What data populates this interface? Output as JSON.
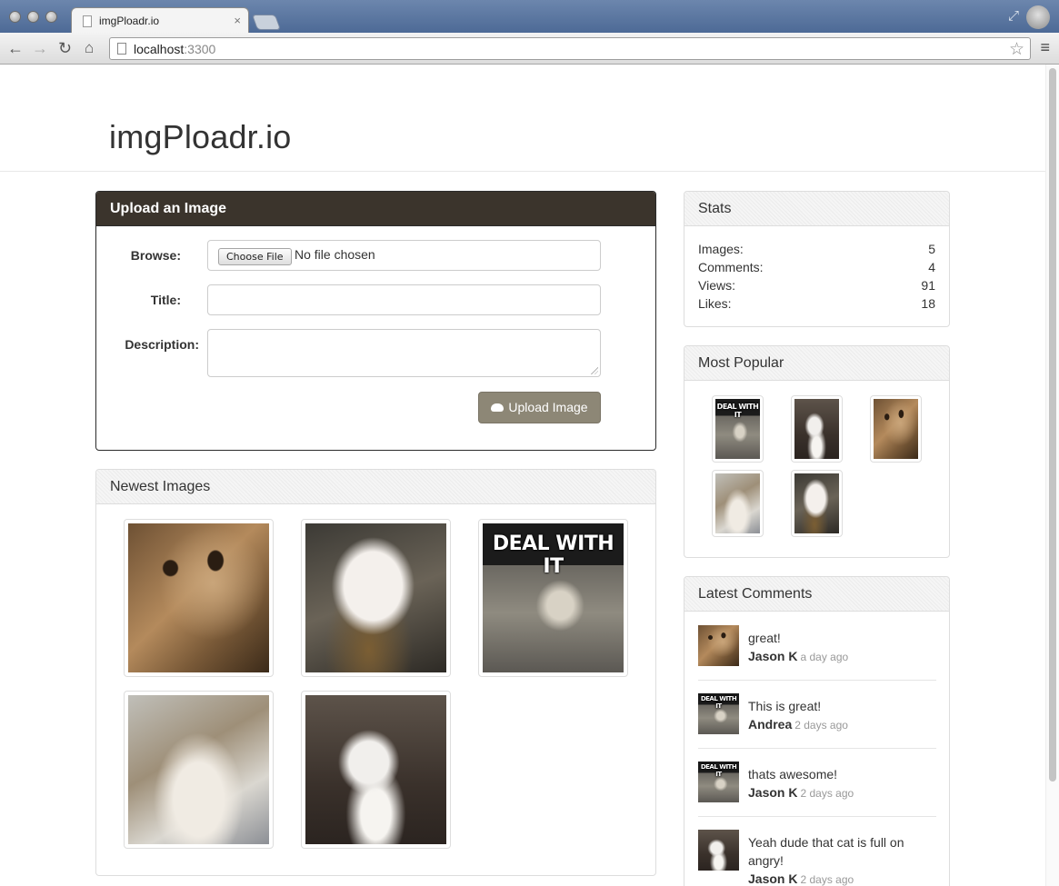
{
  "browser": {
    "tab_title": "imgPloadr.io",
    "tab_close": "×",
    "url_host": "localhost",
    "url_port": ":3300",
    "back_icon": "arrow-left",
    "forward_icon": "arrow-right",
    "reload_icon": "reload",
    "home_icon": "home",
    "star_icon": "star",
    "menu_icon": "hamburger"
  },
  "site": {
    "title": "imgPloadr.io"
  },
  "upload": {
    "heading": "Upload an Image",
    "browse_label": "Browse:",
    "choose_file": "Choose File",
    "file_status": "No file chosen",
    "title_label": "Title:",
    "title_value": "",
    "description_label": "Description:",
    "description_value": "",
    "submit_label": "Upload Image",
    "accent": "#8d8776",
    "header_color": "#3b342c"
  },
  "newest": {
    "heading": "Newest Images",
    "images": [
      {
        "meme_text": ""
      },
      {
        "meme_text": ""
      },
      {
        "meme_text": "DEAL WITH IT"
      },
      {
        "meme_text": ""
      },
      {
        "meme_text": ""
      }
    ]
  },
  "stats": {
    "heading": "Stats",
    "rows": [
      {
        "label": "Images:",
        "value": "5"
      },
      {
        "label": "Comments:",
        "value": "4"
      },
      {
        "label": "Views:",
        "value": "91"
      },
      {
        "label": "Likes:",
        "value": "18"
      }
    ]
  },
  "popular": {
    "heading": "Most Popular",
    "images": [
      {
        "meme_text": "DEAL WITH IT"
      },
      {
        "meme_text": ""
      },
      {
        "meme_text": ""
      },
      {
        "meme_text": ""
      },
      {
        "meme_text": ""
      }
    ]
  },
  "comments": {
    "heading": "Latest Comments",
    "items": [
      {
        "text": "great!",
        "author": "Jason K",
        "time": "a day ago",
        "thumb_meme": ""
      },
      {
        "text": "This is great!",
        "author": "Andrea",
        "time": "2 days ago",
        "thumb_meme": "DEAL WITH IT"
      },
      {
        "text": "thats awesome!",
        "author": "Jason K",
        "time": "2 days ago",
        "thumb_meme": "DEAL WITH IT"
      },
      {
        "text": "Yeah dude that cat is full on angry!",
        "author": "Jason K",
        "time": "2 days ago",
        "thumb_meme": ""
      }
    ]
  }
}
